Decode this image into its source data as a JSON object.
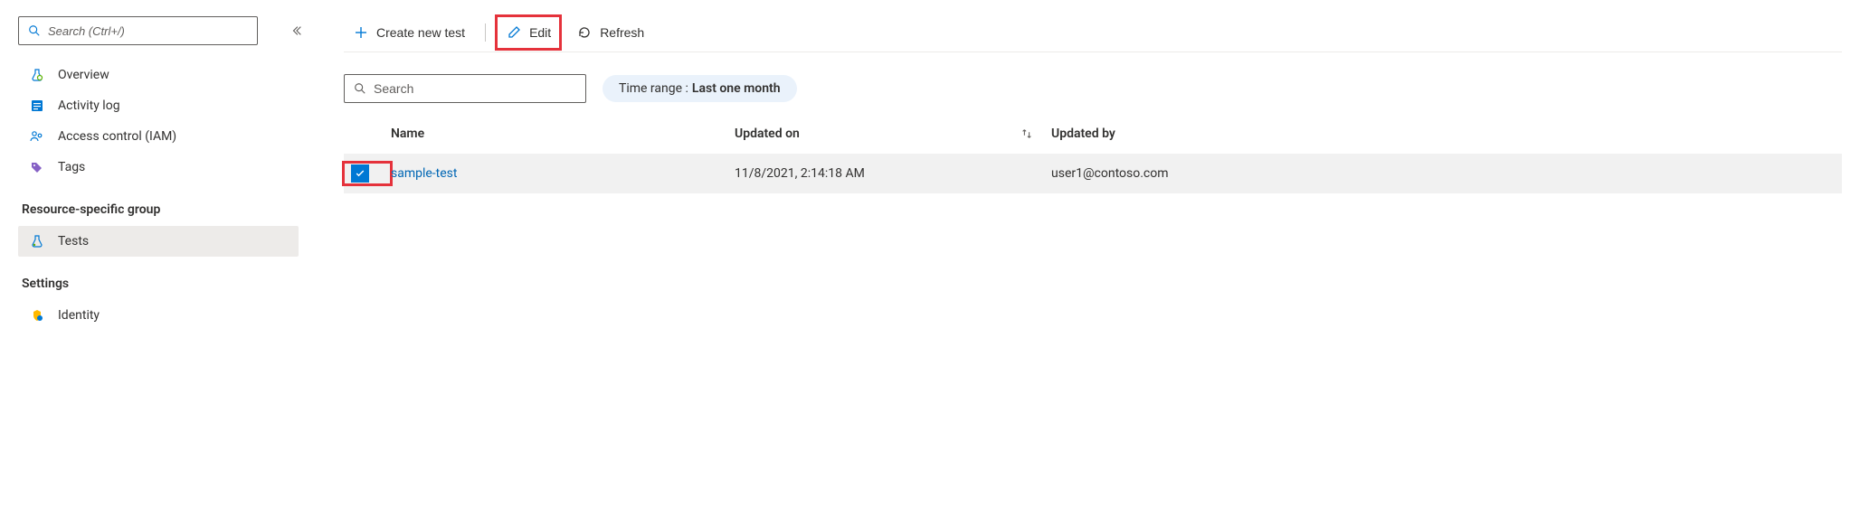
{
  "sidebar": {
    "search_placeholder": "Search (Ctrl+/)",
    "nav": {
      "overview": "Overview",
      "activity_log": "Activity log",
      "iam": "Access control (IAM)",
      "tags": "Tags"
    },
    "section_resource": "Resource-specific group",
    "tests": "Tests",
    "section_settings": "Settings",
    "identity": "Identity"
  },
  "toolbar": {
    "create": "Create new test",
    "edit": "Edit",
    "refresh": "Refresh"
  },
  "filter": {
    "search_placeholder": "Search",
    "time_range_label": "Time range :",
    "time_range_value": "Last one month"
  },
  "table": {
    "columns": {
      "name": "Name",
      "updated_on": "Updated on",
      "updated_by": "Updated by"
    },
    "rows": [
      {
        "checked": true,
        "name": "sample-test",
        "updated_on": "11/8/2021, 2:14:18 AM",
        "updated_by": "user1@contoso.com"
      }
    ]
  }
}
